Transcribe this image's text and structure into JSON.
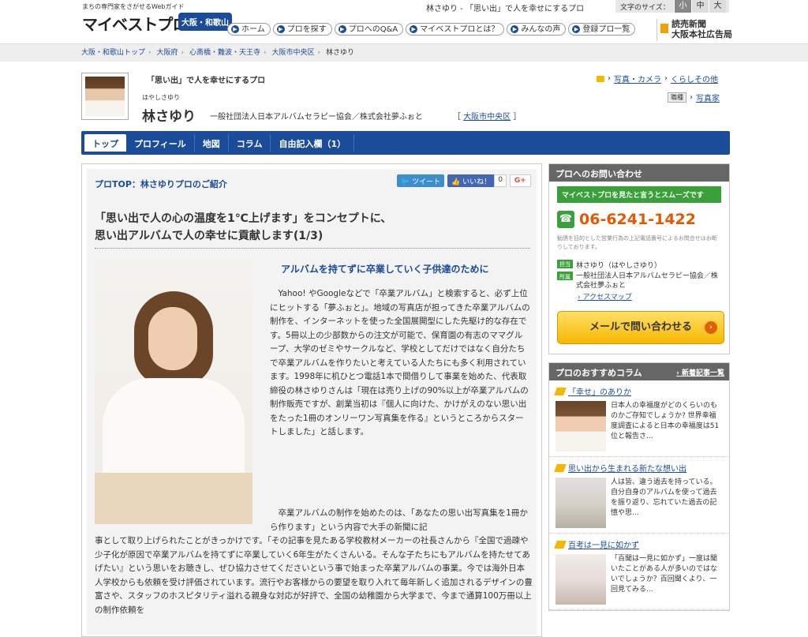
{
  "site": {
    "tagline": "まちの専門家をさがせるWebガイド",
    "logo": "マイベストプロ",
    "logo_badge": "大阪・和歌山",
    "doc_title": "林さゆり - 「思い出」で人を幸せにするプロ",
    "font_size_label": "文字のサイズ：",
    "font_sizes": [
      "小",
      "中",
      "大"
    ],
    "nav": [
      "ホーム",
      "プロを探す",
      "プロへのQ&A",
      "マイベストプロとは？",
      "みんなの声",
      "登録プロ一覧"
    ],
    "partner": "読売新聞\n大阪本社広告局"
  },
  "breadcrumb": [
    "大阪・和歌山トップ",
    "大阪府",
    "心斎橋・難波・天王寺",
    "大阪市中央区",
    "林さゆり"
  ],
  "profile": {
    "catch": "「思い出」で人を幸せにするプロ",
    "reading": "はやしさゆり",
    "name": "林さゆり",
    "org": "一般社団法人日本アルバムセラピー協会／株式会社夢ふぉと",
    "area": "大阪市中央区",
    "categories": [
      "写真・カメラ",
      "くらしその他"
    ],
    "job_label": "職種",
    "job": "写真家"
  },
  "tabs": [
    "トップ",
    "プロフィール",
    "地図",
    "コラム",
    "自由記入欄（1）"
  ],
  "article": {
    "protop": "プロTOP：林さゆりプロのご紹介",
    "tweet": "ツイート",
    "like": "いいね！",
    "like_count": "0",
    "gplus": "G+",
    "headline": "「思い出で人の心の温度を1℃上げます」をコンセプトに、\n思い出アルバムで人の幸せに貢献します(1/3)",
    "subhead": "アルバムを持てずに卒業していく子供達のために",
    "para1": "Yahoo! やGoogleなどで「卒業アルバム」と検索すると、必ず上位にヒットする「夢ふぉと」。地域の写真店が担ってきた卒業アルバムの制作を、インターネットを使った全国展開型にした先駆け的な存在です。5冊以上の少部数からの注文が可能で、保育園の有志のママグループ、大学のゼミやサークルなど、学校としてだけではなく自分たちで卒業アルバムを作りたいと考えている人たちにも多く利用されています。1998年に机ひとつ電話1本で間借りして事業を始めた、代表取締役の林さゆりさんは「現在は売り上げの90%以上が卒業アルバムの制作販売ですが、創業当初は『個人に向けた、かけがえのない思い出をたった1冊のオンリーワン写真集を作る』というところからスタートしました」と話します。",
    "para2_lead": "卒業アルバムの制作を始めたのは、「あなたの思い出写真集を1冊から作ります」という内容で大手の新聞に記",
    "para2_rest": "事として取り上げられたことがきっかけです。「その記事を見たある学校教材メーカーの社長さんから『全国で過疎や少子化が原因で卒業アルバムを持てずに卒業していく6年生がたくさんいる。そんな子たちにもアルバムを持たせてあげたい』という思いをお聴きし、ぜひ協力させてくださいという事で始まった卒業アルバムの事業。今では海外日本人学校からも依頼を受け評価されています。流行やお客様からの要望を取り入れて毎年新しく追加されるデザインの豊富さや、スタッフのホスピタリティ溢れる親身な対応が好評で、全国の幼稚園から大学まで、今まで通算100万冊以上の制作依頼を"
  },
  "contact": {
    "title": "プロへのお問い合わせ",
    "smooth": "マイベストプロを見たと言うとスムーズです",
    "phone": "06-6241-1422",
    "note": "勧誘を目的とした営業行為の上記電話番号によるお問合せはお断りしております。",
    "tantou_label": "担当",
    "tantou": "林さゆり（はやしさゆり）",
    "org_label": "所属",
    "org": "一般社団法人日本アルバムセラピー協会／株式会社夢ふぉと",
    "access": "アクセスマップ",
    "mail": "メールで問い合わせる"
  },
  "columns": {
    "title": "プロのおすすめコラム",
    "more": "新着記事一覧",
    "items": [
      {
        "title": "「幸せ」のありか",
        "text": "日本人の幸福度がどのくらいのものかご存知でしょうか? 世界幸福度調査によると日本の幸福度は51位と報告さ..."
      },
      {
        "title": "思い出から生まれる新たな想い出",
        "text": "人は皆、違う過去を持っている。自分自身のアルバムを使って過去を振り返り、忘れていた過去の記憶や思..."
      },
      {
        "title": "百考は一見に如かず",
        "text": "「百聞は一見に如かず」一度は聞いたことがある人が多いのではないでしょうか？百回聞くより、一回見てみる..."
      }
    ]
  }
}
